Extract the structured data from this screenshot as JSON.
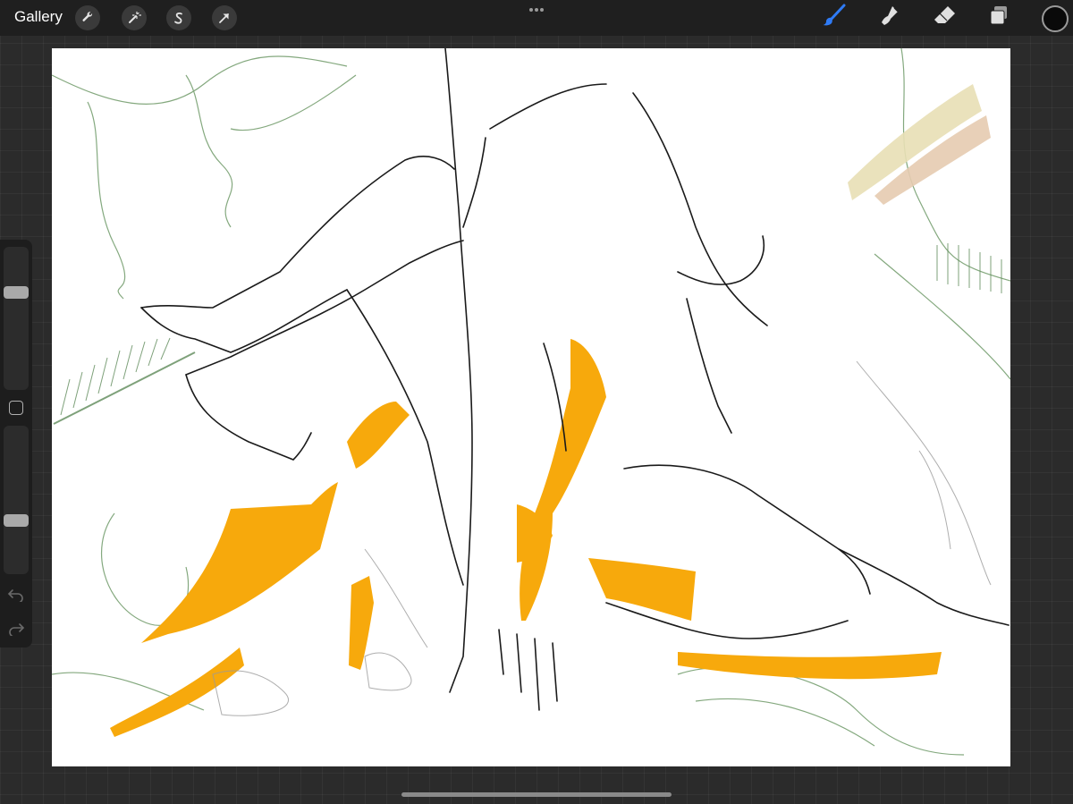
{
  "topbar": {
    "gallery_label": "Gallery",
    "left_tools": [
      "wrench-icon",
      "magic-wand-icon",
      "selection-icon",
      "transform-arrow-icon"
    ],
    "right_tools": [
      "brush-icon",
      "smudge-icon",
      "eraser-icon",
      "layers-icon"
    ],
    "active_tool": "brush-icon",
    "accent_color": "#2f7bf5",
    "current_color": "#0a0a0a"
  },
  "sidebar": {
    "brush_size_fraction": 0.7,
    "opacity_fraction": 0.35,
    "controls": [
      "modify-button",
      "undo-icon",
      "redo-icon"
    ]
  },
  "canvas": {
    "background": "#ffffff",
    "palette": {
      "orange_paint": "#f7a90c",
      "line_work": "#1a1a1a",
      "green_sketch": "#5f8a5a",
      "swatch_cream": "#e8dfb5",
      "swatch_peach": "#e6cbb0"
    }
  }
}
